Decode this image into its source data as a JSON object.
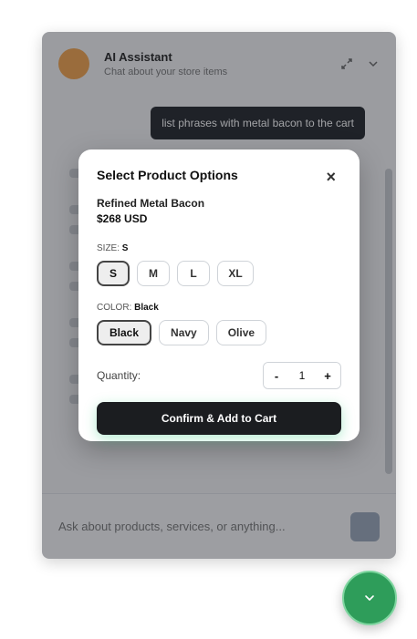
{
  "chat": {
    "assistant_name": "AI Assistant",
    "assistant_subtitle": "Chat about your store items",
    "user_message": "list phrases with metal bacon to the cart",
    "input_placeholder": "Ask about products, services, or anything..."
  },
  "modal": {
    "title": "Select Product Options",
    "close_glyph": "×",
    "product_name": "Refined Metal Bacon",
    "product_price": "$268 USD",
    "size": {
      "label": "SIZE:",
      "selected": "S",
      "options": [
        "S",
        "M",
        "L",
        "XL"
      ]
    },
    "color": {
      "label": "COLOR:",
      "selected": "Black",
      "options": [
        "Black",
        "Navy",
        "Olive"
      ]
    },
    "quantity": {
      "label": "Quantity:",
      "minus": "-",
      "value": "1",
      "plus": "+"
    },
    "confirm_label": "Confirm & Add to Cart"
  },
  "colors": {
    "accent": "#2e9d5a",
    "primary_button": "#1b1d20",
    "avatar": "#f3a24a"
  },
  "icons": {
    "fab": "chevron-down-icon",
    "close": "close-icon"
  }
}
